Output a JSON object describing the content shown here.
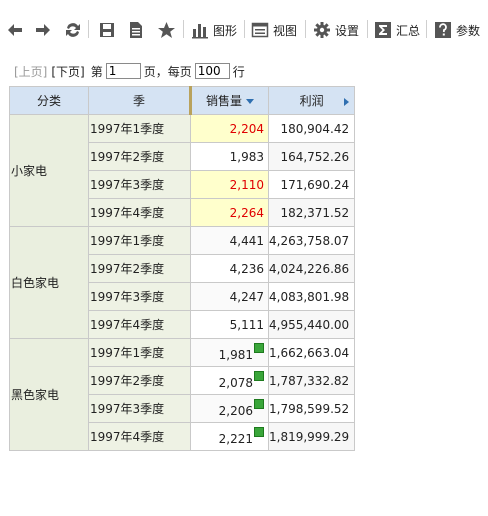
{
  "toolbar": {
    "back": "back-icon",
    "forward": "forward-icon",
    "refresh": "refresh-icon",
    "save": "save-icon",
    "export": "export-icon",
    "favorite": "star-icon",
    "chart_label": "图形",
    "view_label": "视图",
    "settings_label": "设置",
    "summary_label": "汇总",
    "params_label": "参数"
  },
  "pager": {
    "prev_label": "[上页]",
    "next_label": "[下页]",
    "page_prefix": "第",
    "page_value": "1",
    "page_suffix": "页，每页",
    "size_value": "100",
    "size_suffix": "行"
  },
  "table": {
    "headers": [
      "分类",
      "季",
      "销售量",
      "利润"
    ],
    "groups": [
      {
        "category": "小家电",
        "rows": [
          {
            "season": "1997年1季度",
            "sales": "2,204",
            "profit": "180,904.42"
          },
          {
            "season": "1997年2季度",
            "sales": "1,983",
            "profit": "164,752.26"
          },
          {
            "season": "1997年3季度",
            "sales": "2,110",
            "profit": "171,690.24"
          },
          {
            "season": "1997年4季度",
            "sales": "2,264",
            "profit": "182,371.52"
          }
        ]
      },
      {
        "category": "白色家电",
        "rows": [
          {
            "season": "1997年1季度",
            "sales": "4,441",
            "profit": "4,263,758.07"
          },
          {
            "season": "1997年2季度",
            "sales": "4,236",
            "profit": "4,024,226.86"
          },
          {
            "season": "1997年3季度",
            "sales": "4,247",
            "profit": "4,083,801.98"
          },
          {
            "season": "1997年4季度",
            "sales": "5,111",
            "profit": "4,955,440.00"
          }
        ]
      },
      {
        "category": "黑色家电",
        "rows": [
          {
            "season": "1997年1季度",
            "sales": "1,981",
            "profit": "1,662,663.04"
          },
          {
            "season": "1997年2季度",
            "sales": "2,078",
            "profit": "1,787,332.82"
          },
          {
            "season": "1997年3季度",
            "sales": "2,206",
            "profit": "1,798,599.52"
          },
          {
            "season": "1997年4季度",
            "sales": "2,221",
            "profit": "1,819,999.29"
          }
        ]
      }
    ]
  },
  "colors": {
    "header_bg": "#d5e3f3",
    "highlight_bg": "#ffffcc",
    "highlight_text": "#e00000",
    "flag_green": "#3aa63a",
    "category_bg": "#eaefdf"
  }
}
